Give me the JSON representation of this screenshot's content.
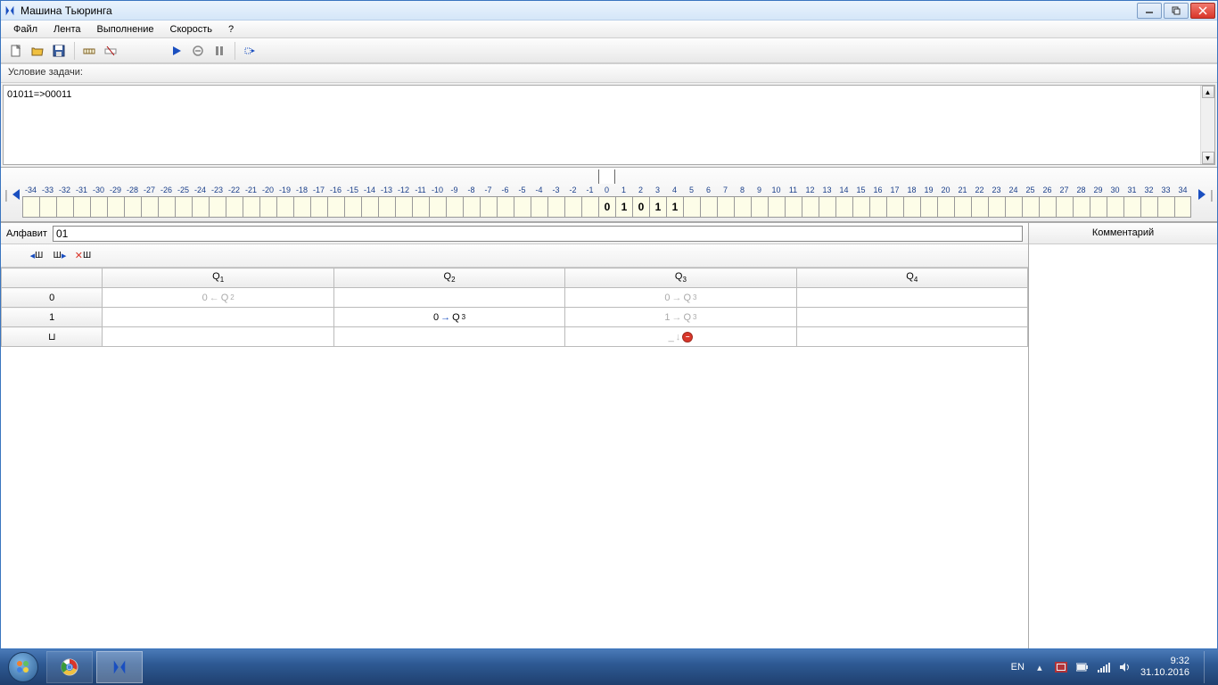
{
  "window": {
    "title": "Машина Тьюринга"
  },
  "menu": {
    "file": "Файл",
    "tape": "Лента",
    "run": "Выполнение",
    "speed": "Скорость",
    "help": "?"
  },
  "problem": {
    "label": "Условие задачи:",
    "text": "01011=>00011"
  },
  "tape": {
    "start": -34,
    "end": 34,
    "head": 0,
    "cells": {
      "0": "0",
      "1": "1",
      "2": "0",
      "3": "1",
      "4": "1"
    }
  },
  "alphabet": {
    "label": "Алфавит",
    "value": "01"
  },
  "states": [
    "Q1",
    "Q2",
    "Q3",
    "Q4"
  ],
  "symbols": [
    "0",
    "1",
    "_"
  ],
  "program": {
    "0": {
      "Q1": {
        "write": "0",
        "dir": "←",
        "next": "Q2",
        "dim": true
      },
      "Q3": {
        "write": "0",
        "dir": "→",
        "next": "Q3",
        "dim": true
      }
    },
    "1": {
      "Q2": {
        "write": "0",
        "dir": "→",
        "next": "Q3",
        "dim": false
      },
      "Q3": {
        "write": "1",
        "dir": "→",
        "next": "Q3",
        "dim": true
      }
    },
    "_": {
      "Q3": {
        "write": "_",
        "dir": "↓",
        "stop": true
      }
    }
  },
  "comment": {
    "header": "Комментарий"
  },
  "tray": {
    "lang": "EN",
    "time": "9:32",
    "date": "31.10.2016"
  }
}
